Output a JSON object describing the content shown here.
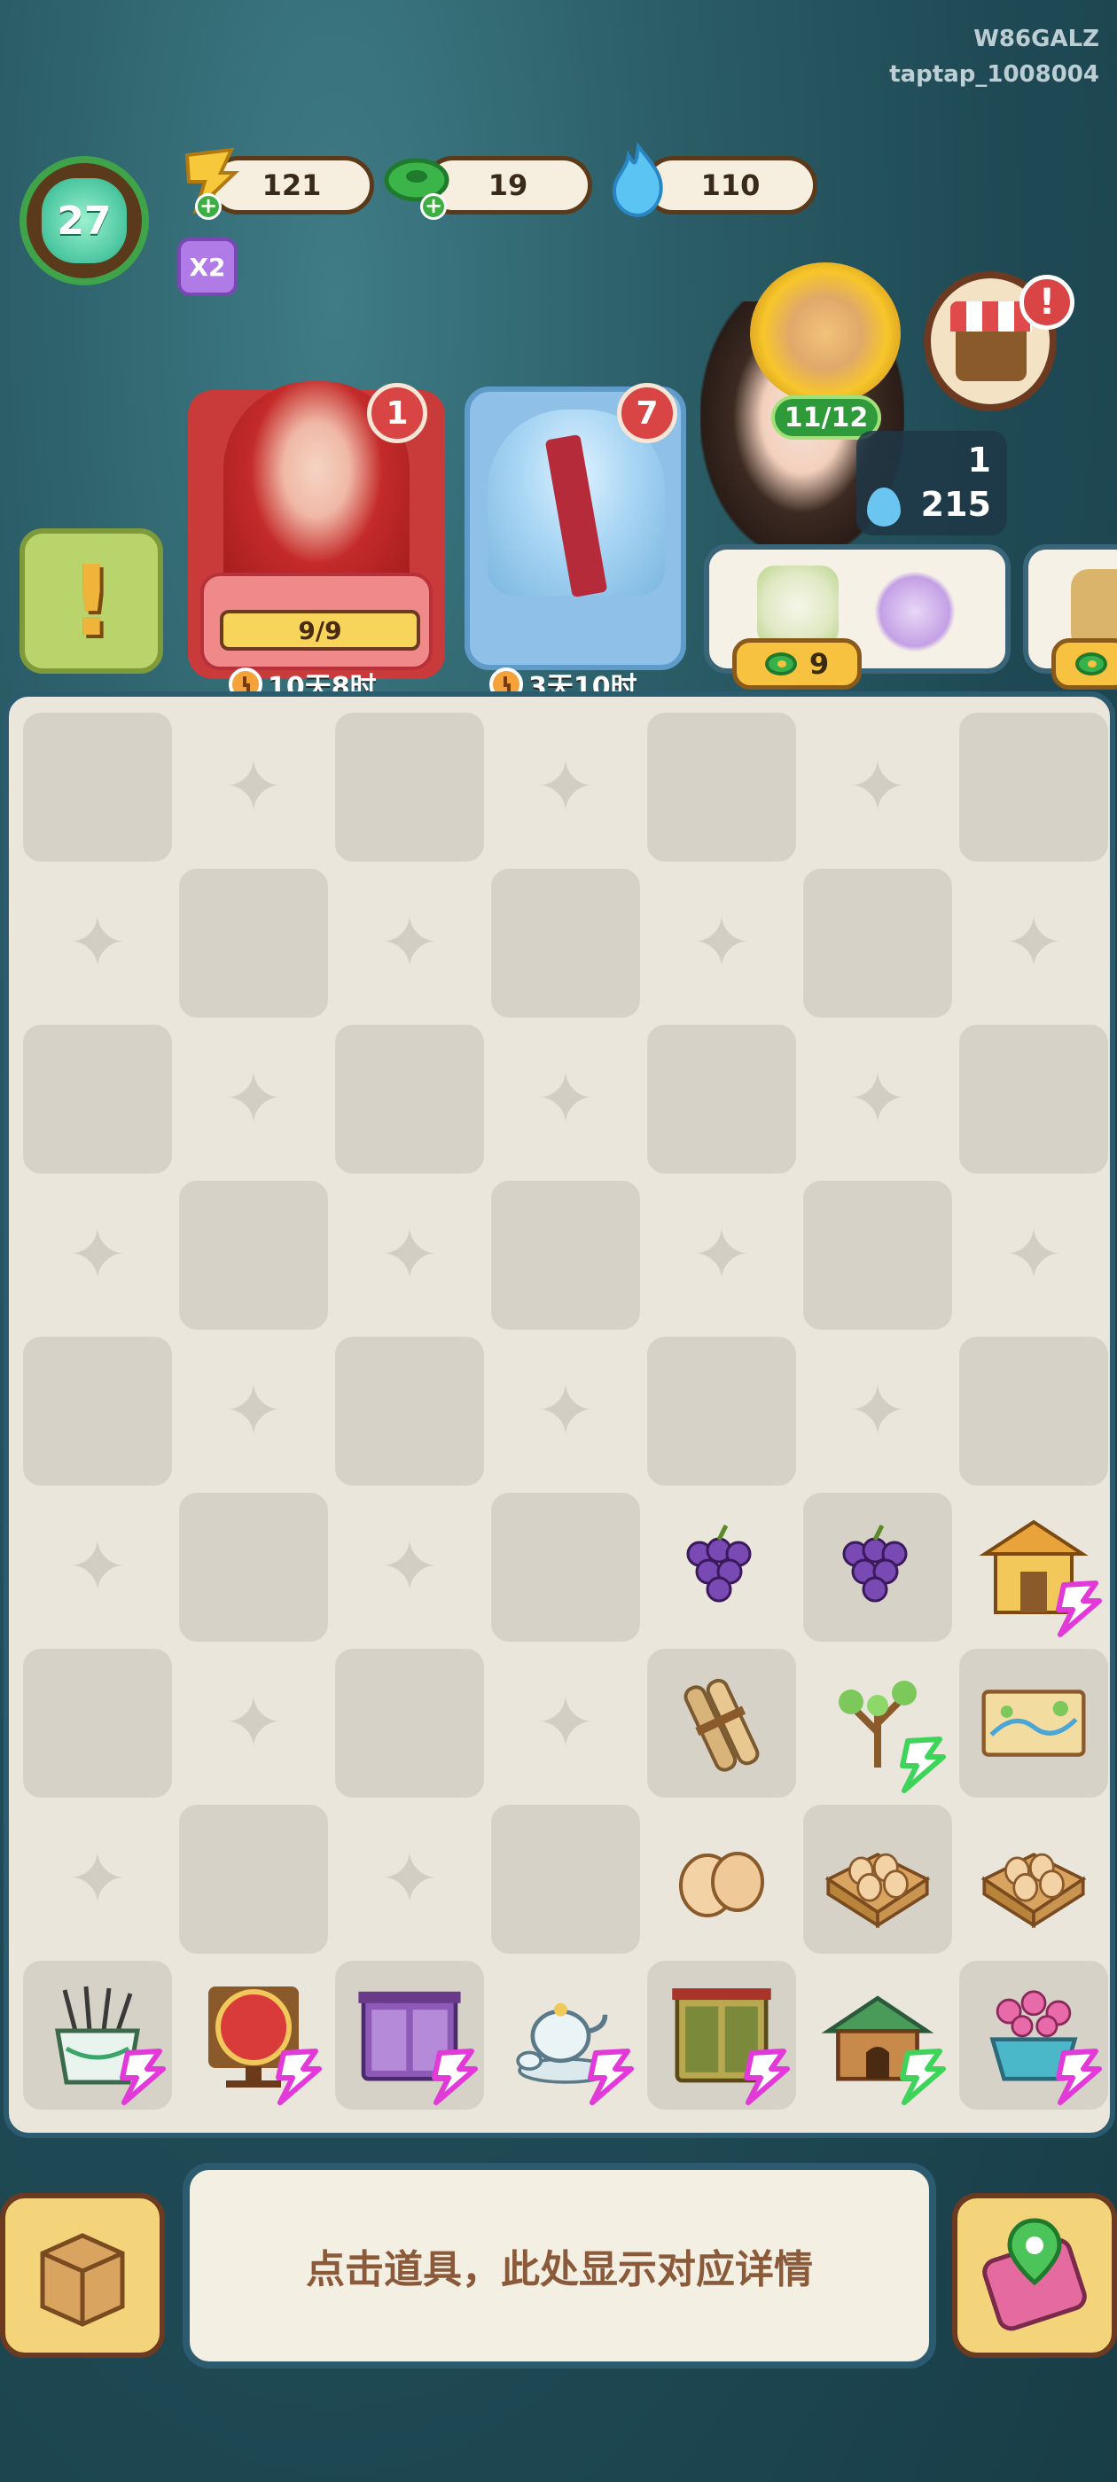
{
  "watermark": {
    "line1": "W86GALZ",
    "line2": "taptap_1008004"
  },
  "player": {
    "level": "27"
  },
  "currencies": [
    {
      "name": "energy",
      "value": "121"
    },
    {
      "name": "jade",
      "value": "19"
    },
    {
      "name": "flame",
      "value": "110"
    }
  ],
  "boost_label": "X2",
  "events": [
    {
      "badge": "1",
      "progress": "9/9",
      "timer": "10天8时"
    },
    {
      "badge": "7",
      "timer": "3天10时"
    }
  ],
  "order": {
    "progress": "11/12",
    "reward_count": "1",
    "reward_flame": "215",
    "price": "9",
    "shop_alert": "!"
  },
  "colors": {
    "board_bg": "#eae6dc",
    "frame": "#2c5b70",
    "bolt_pink": "#e23ad8",
    "bolt_green": "#3ed45a"
  },
  "board_items": [
    {
      "row": 5,
      "col": 4,
      "icon": "grapes-icon"
    },
    {
      "row": 5,
      "col": 5,
      "icon": "grapes-icon"
    },
    {
      "row": 5,
      "col": 6,
      "icon": "golden-pavilion-icon",
      "bolt": "pink"
    },
    {
      "row": 6,
      "col": 4,
      "icon": "scroll-bundle-icon"
    },
    {
      "row": 6,
      "col": 5,
      "icon": "sapling-icon",
      "bolt": "green"
    },
    {
      "row": 6,
      "col": 6,
      "icon": "painting-scroll-icon"
    },
    {
      "row": 7,
      "col": 4,
      "icon": "eggs-icon"
    },
    {
      "row": 7,
      "col": 5,
      "icon": "egg-crate-icon"
    },
    {
      "row": 7,
      "col": 6,
      "icon": "egg-crate-icon"
    },
    {
      "row": 8,
      "col": 0,
      "icon": "brush-pot-icon",
      "bolt": "pink"
    },
    {
      "row": 8,
      "col": 1,
      "icon": "red-fan-screen-icon",
      "bolt": "pink"
    },
    {
      "row": 8,
      "col": 2,
      "icon": "purple-cabinet-icon",
      "bolt": "pink"
    },
    {
      "row": 8,
      "col": 3,
      "icon": "tea-set-icon",
      "bolt": "pink"
    },
    {
      "row": 8,
      "col": 4,
      "icon": "green-cabinet-icon",
      "bolt": "pink"
    },
    {
      "row": 8,
      "col": 5,
      "icon": "doghouse-icon",
      "bolt": "green"
    },
    {
      "row": 8,
      "col": 6,
      "icon": "flower-pot-icon",
      "bolt": "pink"
    }
  ],
  "info_text": "点击道具，此处显示对应详情"
}
